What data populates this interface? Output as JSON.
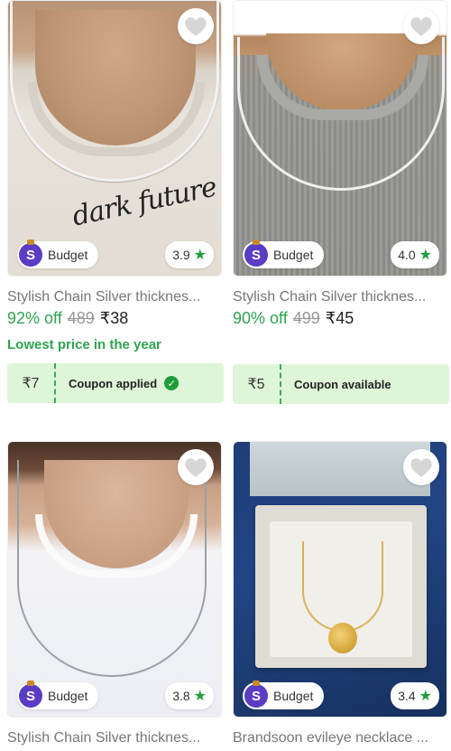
{
  "products": [
    {
      "title": "Stylish Chain Silver thicknes...",
      "discount": "92% off",
      "mrp": "489",
      "price": "₹38",
      "rating": "3.9",
      "badge": "Budget",
      "highlight": "Lowest price in the year",
      "coupon_amount": "₹7",
      "coupon_text": "Coupon applied",
      "print_text": "dark future"
    },
    {
      "title": "Stylish Chain Silver thicknes...",
      "discount": "90% off",
      "mrp": "499",
      "price": "₹45",
      "rating": "4.0",
      "badge": "Budget",
      "coupon_amount": "₹5",
      "coupon_text": "Coupon available"
    },
    {
      "title": "Stylish Chain Silver thicknes...",
      "rating": "3.8",
      "badge": "Budget"
    },
    {
      "title": "Brandsoon evileye necklace ...",
      "rating": "3.4",
      "badge": "Budget"
    }
  ],
  "icons": {
    "wishlist": "heart-icon",
    "rating_star": "star-icon",
    "budget_badge": "s-money-bag-icon",
    "coupon_check": "check-icon"
  },
  "colors": {
    "green": "#2ea44f",
    "coupon_bg": "#dff5d8",
    "budget_purple": "#5b3cc4"
  }
}
